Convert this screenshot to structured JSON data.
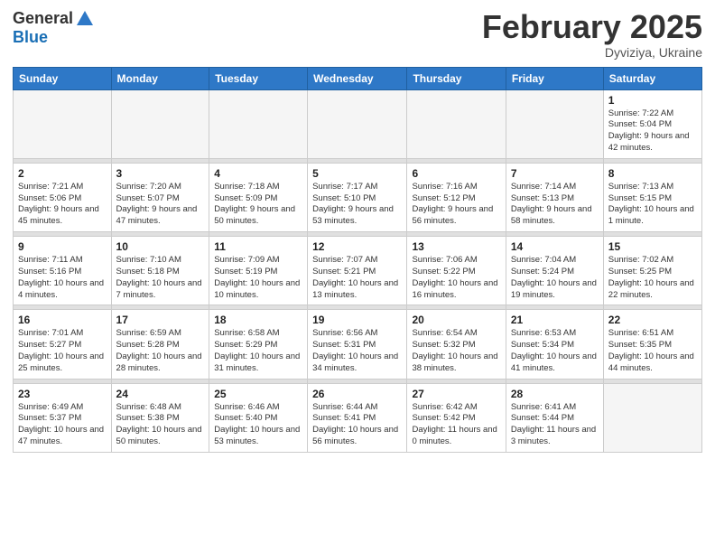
{
  "header": {
    "logo": {
      "general": "General",
      "blue": "Blue"
    },
    "month": "February 2025",
    "location": "Dyviziya, Ukraine"
  },
  "weekdays": [
    "Sunday",
    "Monday",
    "Tuesday",
    "Wednesday",
    "Thursday",
    "Friday",
    "Saturday"
  ],
  "weeks": [
    [
      null,
      null,
      null,
      null,
      null,
      null,
      {
        "day": "1",
        "sunrise": "Sunrise: 7:22 AM",
        "sunset": "Sunset: 5:04 PM",
        "daylight": "Daylight: 9 hours and 42 minutes."
      }
    ],
    [
      {
        "day": "2",
        "sunrise": "Sunrise: 7:21 AM",
        "sunset": "Sunset: 5:06 PM",
        "daylight": "Daylight: 9 hours and 45 minutes."
      },
      {
        "day": "3",
        "sunrise": "Sunrise: 7:20 AM",
        "sunset": "Sunset: 5:07 PM",
        "daylight": "Daylight: 9 hours and 47 minutes."
      },
      {
        "day": "4",
        "sunrise": "Sunrise: 7:18 AM",
        "sunset": "Sunset: 5:09 PM",
        "daylight": "Daylight: 9 hours and 50 minutes."
      },
      {
        "day": "5",
        "sunrise": "Sunrise: 7:17 AM",
        "sunset": "Sunset: 5:10 PM",
        "daylight": "Daylight: 9 hours and 53 minutes."
      },
      {
        "day": "6",
        "sunrise": "Sunrise: 7:16 AM",
        "sunset": "Sunset: 5:12 PM",
        "daylight": "Daylight: 9 hours and 56 minutes."
      },
      {
        "day": "7",
        "sunrise": "Sunrise: 7:14 AM",
        "sunset": "Sunset: 5:13 PM",
        "daylight": "Daylight: 9 hours and 58 minutes."
      },
      {
        "day": "8",
        "sunrise": "Sunrise: 7:13 AM",
        "sunset": "Sunset: 5:15 PM",
        "daylight": "Daylight: 10 hours and 1 minute."
      }
    ],
    [
      {
        "day": "9",
        "sunrise": "Sunrise: 7:11 AM",
        "sunset": "Sunset: 5:16 PM",
        "daylight": "Daylight: 10 hours and 4 minutes."
      },
      {
        "day": "10",
        "sunrise": "Sunrise: 7:10 AM",
        "sunset": "Sunset: 5:18 PM",
        "daylight": "Daylight: 10 hours and 7 minutes."
      },
      {
        "day": "11",
        "sunrise": "Sunrise: 7:09 AM",
        "sunset": "Sunset: 5:19 PM",
        "daylight": "Daylight: 10 hours and 10 minutes."
      },
      {
        "day": "12",
        "sunrise": "Sunrise: 7:07 AM",
        "sunset": "Sunset: 5:21 PM",
        "daylight": "Daylight: 10 hours and 13 minutes."
      },
      {
        "day": "13",
        "sunrise": "Sunrise: 7:06 AM",
        "sunset": "Sunset: 5:22 PM",
        "daylight": "Daylight: 10 hours and 16 minutes."
      },
      {
        "day": "14",
        "sunrise": "Sunrise: 7:04 AM",
        "sunset": "Sunset: 5:24 PM",
        "daylight": "Daylight: 10 hours and 19 minutes."
      },
      {
        "day": "15",
        "sunrise": "Sunrise: 7:02 AM",
        "sunset": "Sunset: 5:25 PM",
        "daylight": "Daylight: 10 hours and 22 minutes."
      }
    ],
    [
      {
        "day": "16",
        "sunrise": "Sunrise: 7:01 AM",
        "sunset": "Sunset: 5:27 PM",
        "daylight": "Daylight: 10 hours and 25 minutes."
      },
      {
        "day": "17",
        "sunrise": "Sunrise: 6:59 AM",
        "sunset": "Sunset: 5:28 PM",
        "daylight": "Daylight: 10 hours and 28 minutes."
      },
      {
        "day": "18",
        "sunrise": "Sunrise: 6:58 AM",
        "sunset": "Sunset: 5:29 PM",
        "daylight": "Daylight: 10 hours and 31 minutes."
      },
      {
        "day": "19",
        "sunrise": "Sunrise: 6:56 AM",
        "sunset": "Sunset: 5:31 PM",
        "daylight": "Daylight: 10 hours and 34 minutes."
      },
      {
        "day": "20",
        "sunrise": "Sunrise: 6:54 AM",
        "sunset": "Sunset: 5:32 PM",
        "daylight": "Daylight: 10 hours and 38 minutes."
      },
      {
        "day": "21",
        "sunrise": "Sunrise: 6:53 AM",
        "sunset": "Sunset: 5:34 PM",
        "daylight": "Daylight: 10 hours and 41 minutes."
      },
      {
        "day": "22",
        "sunrise": "Sunrise: 6:51 AM",
        "sunset": "Sunset: 5:35 PM",
        "daylight": "Daylight: 10 hours and 44 minutes."
      }
    ],
    [
      {
        "day": "23",
        "sunrise": "Sunrise: 6:49 AM",
        "sunset": "Sunset: 5:37 PM",
        "daylight": "Daylight: 10 hours and 47 minutes."
      },
      {
        "day": "24",
        "sunrise": "Sunrise: 6:48 AM",
        "sunset": "Sunset: 5:38 PM",
        "daylight": "Daylight: 10 hours and 50 minutes."
      },
      {
        "day": "25",
        "sunrise": "Sunrise: 6:46 AM",
        "sunset": "Sunset: 5:40 PM",
        "daylight": "Daylight: 10 hours and 53 minutes."
      },
      {
        "day": "26",
        "sunrise": "Sunrise: 6:44 AM",
        "sunset": "Sunset: 5:41 PM",
        "daylight": "Daylight: 10 hours and 56 minutes."
      },
      {
        "day": "27",
        "sunrise": "Sunrise: 6:42 AM",
        "sunset": "Sunset: 5:42 PM",
        "daylight": "Daylight: 11 hours and 0 minutes."
      },
      {
        "day": "28",
        "sunrise": "Sunrise: 6:41 AM",
        "sunset": "Sunset: 5:44 PM",
        "daylight": "Daylight: 11 hours and 3 minutes."
      },
      null
    ]
  ]
}
